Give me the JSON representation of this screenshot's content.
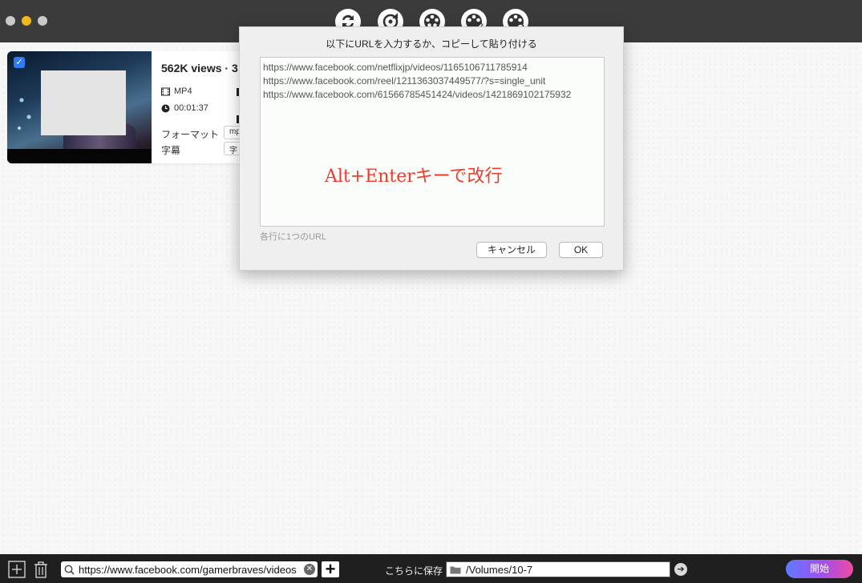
{
  "toolbar": {
    "icons": [
      "convert-icon",
      "rotate-convert-icon",
      "video-reel-icon",
      "video-edit-icon",
      "video-settings-icon"
    ]
  },
  "card": {
    "title": "562K views · 3",
    "format_badge": "MP4",
    "duration": "00:01:37",
    "format_label": "フォーマット",
    "format_value": "mp",
    "subtitle_label": "字幕",
    "subtitle_value": "字",
    "checked": "✓"
  },
  "dialog": {
    "title": "以下にURLを入力するか、コピーして貼り付ける",
    "urls": [
      "https://www.facebook.com/netflixjp/videos/1165106711785914",
      "https://www.facebook.com/reel/1211363037449577/?s=single_unit",
      "https://www.facebook.com/61566785451424/videos/1421869102175932"
    ],
    "annotation": "Alt+Enterキーで改行",
    "note": "各行に1つのURL",
    "cancel_label": "キャンセル",
    "ok_label": "OK"
  },
  "bottombar": {
    "url_input": "https://www.facebook.com/gamerbraves/videos",
    "save_label": "こちらに保存",
    "save_path": "/Volumes/10-7",
    "start_label": "開始",
    "accent_start": "#5f7bff",
    "accent_end": "#f04aa0"
  }
}
